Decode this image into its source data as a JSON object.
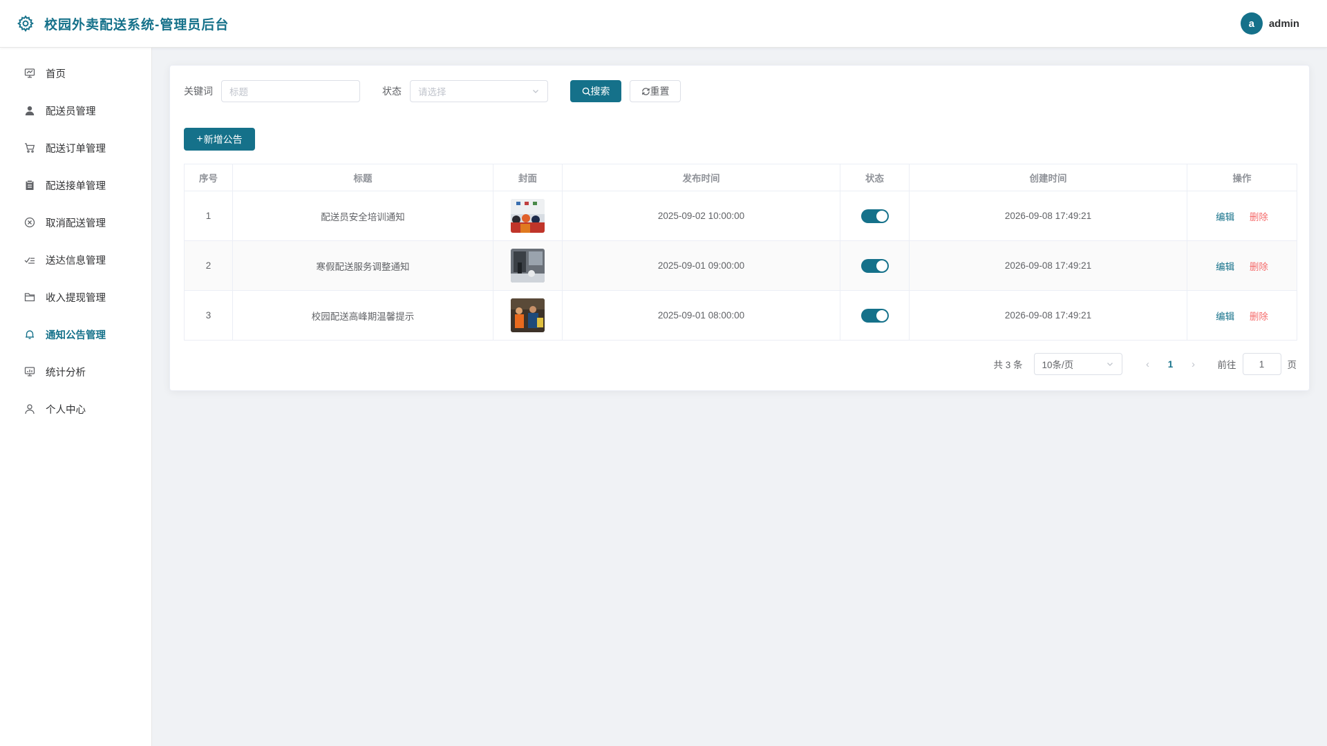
{
  "header": {
    "title": "校园外卖配送系统-管理员后台",
    "avatar_letter": "a",
    "username": "admin"
  },
  "sidebar": {
    "items": [
      {
        "label": "首页",
        "icon": "monitor-icon"
      },
      {
        "label": "配送员管理",
        "icon": "user-fill-icon"
      },
      {
        "label": "配送订单管理",
        "icon": "cart-icon"
      },
      {
        "label": "配送接单管理",
        "icon": "clipboard-icon"
      },
      {
        "label": "取消配送管理",
        "icon": "circle-close-icon"
      },
      {
        "label": "送达信息管理",
        "icon": "check-list-icon"
      },
      {
        "label": "收入提现管理",
        "icon": "folder-icon"
      },
      {
        "label": "通知公告管理",
        "icon": "bell-icon",
        "active": true
      },
      {
        "label": "统计分析",
        "icon": "monitor-chart-icon"
      },
      {
        "label": "个人中心",
        "icon": "user-icon"
      }
    ]
  },
  "search": {
    "keyword_label": "关键词",
    "keyword_placeholder": "标题",
    "status_label": "状态",
    "status_placeholder": "请选择",
    "search_button": "搜索",
    "reset_button": "重置"
  },
  "add_button": "新增公告",
  "table": {
    "headers": [
      "序号",
      "标题",
      "封面",
      "发布时间",
      "状态",
      "创建时间",
      "操作"
    ],
    "rows": [
      {
        "index": "1",
        "title": "配送员安全培训通知",
        "publish_time": "2025-09-02 10:00:00",
        "status_on": true,
        "created_time": "2026-09-08 17:49:21"
      },
      {
        "index": "2",
        "title": "寒假配送服务调整通知",
        "publish_time": "2025-09-01 09:00:00",
        "status_on": true,
        "created_time": "2026-09-08 17:49:21"
      },
      {
        "index": "3",
        "title": "校园配送高峰期温馨提示",
        "publish_time": "2025-09-01 08:00:00",
        "status_on": true,
        "created_time": "2026-09-08 17:49:21"
      }
    ],
    "edit_label": "编辑",
    "delete_label": "删除"
  },
  "pagination": {
    "total_text": "共 3 条",
    "page_size": "10条/页",
    "current_page": "1",
    "goto_label": "前往",
    "goto_value": "1",
    "page_suffix": "页"
  },
  "colors": {
    "primary": "#15718a",
    "danger": "#f56c6c"
  }
}
